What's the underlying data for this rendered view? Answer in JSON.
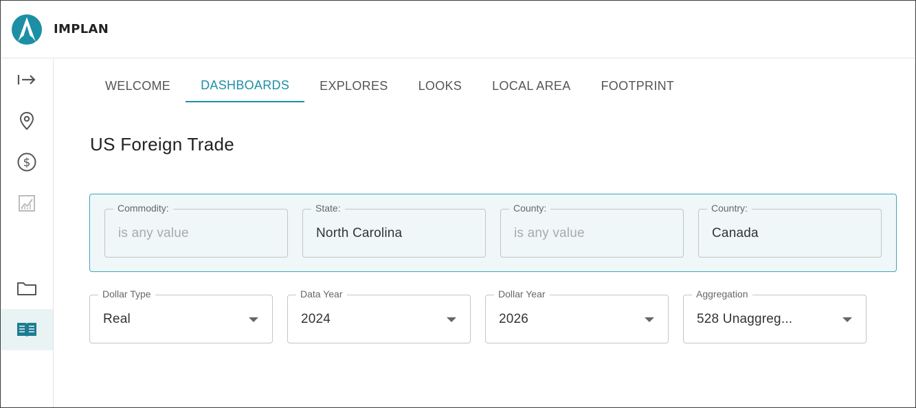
{
  "app": {
    "name": "IMPLAN"
  },
  "colors": {
    "accent": "#1c8fa5",
    "panel_bg": "#eff7f8",
    "panel_border": "#3aa7bb"
  },
  "sidebar": {
    "items": [
      {
        "icon": "expand-arrow-icon"
      },
      {
        "icon": "location-pin-icon"
      },
      {
        "icon": "dollar-circle-icon"
      },
      {
        "icon": "chart-icon"
      },
      {
        "icon": "folder-icon"
      },
      {
        "icon": "book-icon",
        "active": true
      }
    ]
  },
  "tabs": [
    {
      "label": "WELCOME"
    },
    {
      "label": "DASHBOARDS",
      "active": true
    },
    {
      "label": "EXPLORES"
    },
    {
      "label": "LOOKS"
    },
    {
      "label": "LOCAL AREA"
    },
    {
      "label": "FOOTPRINT"
    }
  ],
  "page": {
    "title": "US Foreign Trade"
  },
  "filters": [
    {
      "label": "Commodity:",
      "value": "is any value",
      "placeholder": true
    },
    {
      "label": "State:",
      "value": "North Carolina",
      "placeholder": false
    },
    {
      "label": "County:",
      "value": "is any value",
      "placeholder": true
    },
    {
      "label": "Country:",
      "value": "Canada",
      "placeholder": false
    }
  ],
  "selects": [
    {
      "label": "Dollar Type",
      "value": "Real"
    },
    {
      "label": "Data Year",
      "value": "2024"
    },
    {
      "label": "Dollar Year",
      "value": "2026"
    },
    {
      "label": "Aggregation",
      "value": "528 Unaggreg..."
    }
  ]
}
